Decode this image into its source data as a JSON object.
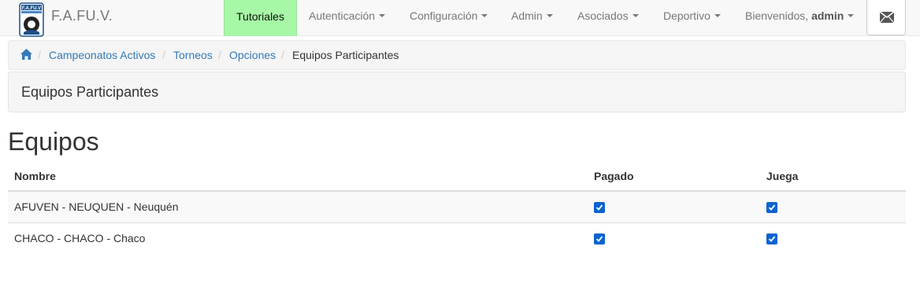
{
  "navbar": {
    "brand_logo_text": "F.A.FU.V",
    "brand_name": "F.A.FU.V.",
    "tutoriales": "Tutoriales",
    "menus": [
      {
        "label": "Autenticación"
      },
      {
        "label": "Configuración"
      },
      {
        "label": "Admin"
      },
      {
        "label": "Asociados"
      },
      {
        "label": "Deportivo"
      }
    ],
    "welcome_prefix": "Bienvenidos, ",
    "welcome_user": "admin",
    "mail_icon": "envelope-icon"
  },
  "breadcrumb": {
    "home_icon": "home-icon",
    "items": [
      "Campeonatos Activos",
      "Torneos",
      "Opciones"
    ],
    "active": "Equipos Participantes"
  },
  "panel": {
    "title": "Equipos Participantes"
  },
  "main": {
    "heading": "Equipos",
    "table": {
      "columns": [
        "Nombre",
        "Pagado",
        "Juega"
      ],
      "rows": [
        {
          "nombre": "AFUVEN - NEUQUEN - Neuquén",
          "pagado": true,
          "juega": true
        },
        {
          "nombre": "CHACO - CHACO - Chaco",
          "pagado": true,
          "juega": true
        }
      ]
    }
  },
  "colors": {
    "accent": "#337ab7",
    "tutoriales_bg": "#a6f7a6",
    "checkbox": "#0a63d1"
  }
}
